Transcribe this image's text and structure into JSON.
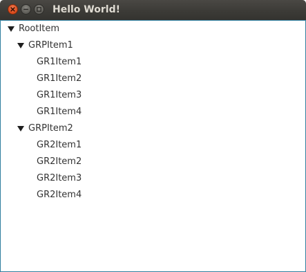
{
  "window": {
    "title": "Hello World!"
  },
  "tree": {
    "root": {
      "label": "RootItem",
      "expanded": true,
      "groups": [
        {
          "label": "GRPItem1",
          "expanded": true,
          "items": [
            "GR1Item1",
            "GR1Item2",
            "GR1Item3",
            "GR1Item4"
          ]
        },
        {
          "label": "GRPItem2",
          "expanded": true,
          "items": [
            "GR2Item1",
            "GR2Item2",
            "GR2Item3",
            "GR2Item4"
          ]
        }
      ]
    }
  },
  "icons": {
    "close": "close-icon",
    "minimize": "minimize-icon",
    "maximize": "maximize-icon",
    "expanded": "triangle-down-icon"
  },
  "colors": {
    "titlebar": "#3c3b37",
    "title_text": "#dfdbd2",
    "close_button": "#e0592a",
    "border_accent": "#2f7e9e",
    "tree_text": "#333333"
  }
}
